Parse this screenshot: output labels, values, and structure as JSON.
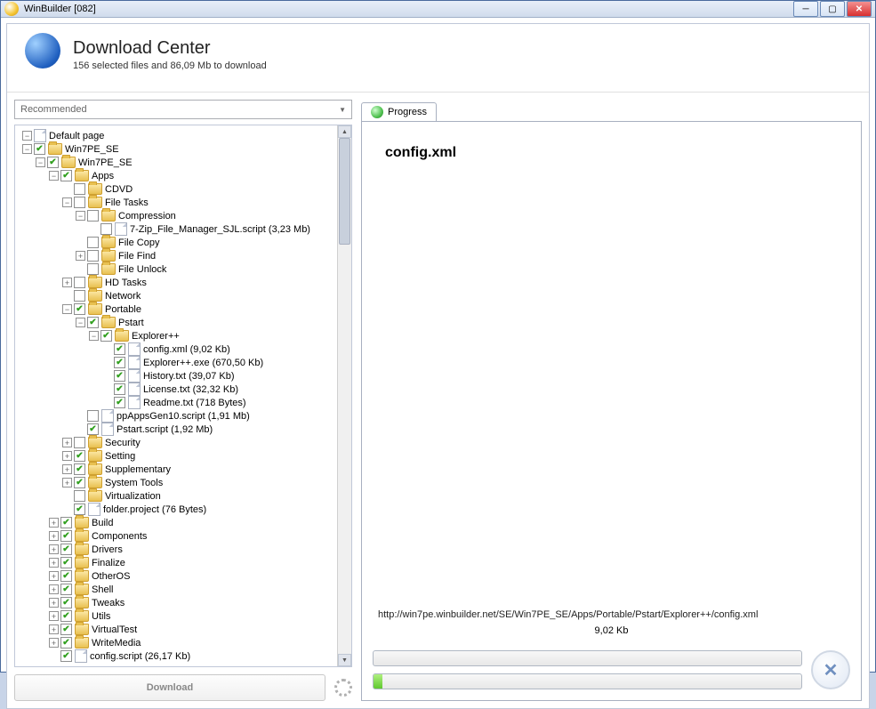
{
  "window": {
    "title": "WinBuilder [082]"
  },
  "header": {
    "title": "Download Center",
    "subtitle": "156 selected files and 86,09 Mb to download"
  },
  "combo": {
    "label": "Recommended"
  },
  "tree": [
    {
      "d": 0,
      "exp": "-",
      "chk": null,
      "ico": "file",
      "label": "Default page"
    },
    {
      "d": 0,
      "exp": "-",
      "chk": true,
      "ico": "folder",
      "label": "Win7PE_SE"
    },
    {
      "d": 1,
      "exp": "-",
      "chk": true,
      "ico": "folder",
      "label": "Win7PE_SE"
    },
    {
      "d": 2,
      "exp": "-",
      "chk": true,
      "ico": "folder",
      "label": "Apps"
    },
    {
      "d": 3,
      "exp": "",
      "chk": false,
      "ico": "folder",
      "label": "CDVD"
    },
    {
      "d": 3,
      "exp": "-",
      "chk": false,
      "ico": "folder",
      "label": "File Tasks"
    },
    {
      "d": 4,
      "exp": "-",
      "chk": false,
      "ico": "folder",
      "label": "Compression"
    },
    {
      "d": 5,
      "exp": "",
      "chk": false,
      "ico": "file",
      "label": "7-Zip_File_Manager_SJL.script (3,23 Mb)"
    },
    {
      "d": 4,
      "exp": "",
      "chk": false,
      "ico": "folder",
      "label": "File Copy"
    },
    {
      "d": 4,
      "exp": "+",
      "chk": false,
      "ico": "folder",
      "label": "File Find"
    },
    {
      "d": 4,
      "exp": "",
      "chk": false,
      "ico": "folder",
      "label": "File Unlock"
    },
    {
      "d": 3,
      "exp": "+",
      "chk": false,
      "ico": "folder",
      "label": "HD Tasks"
    },
    {
      "d": 3,
      "exp": "",
      "chk": false,
      "ico": "folder",
      "label": "Network"
    },
    {
      "d": 3,
      "exp": "-",
      "chk": true,
      "ico": "folder",
      "label": "Portable"
    },
    {
      "d": 4,
      "exp": "-",
      "chk": true,
      "ico": "folder",
      "label": "Pstart"
    },
    {
      "d": 5,
      "exp": "-",
      "chk": true,
      "ico": "folder",
      "label": "Explorer++"
    },
    {
      "d": 6,
      "exp": "",
      "chk": true,
      "ico": "file",
      "label": "config.xml (9,02 Kb)"
    },
    {
      "d": 6,
      "exp": "",
      "chk": true,
      "ico": "file",
      "label": "Explorer++.exe (670,50 Kb)"
    },
    {
      "d": 6,
      "exp": "",
      "chk": true,
      "ico": "file",
      "label": "History.txt (39,07 Kb)"
    },
    {
      "d": 6,
      "exp": "",
      "chk": true,
      "ico": "file",
      "label": "License.txt (32,32 Kb)"
    },
    {
      "d": 6,
      "exp": "",
      "chk": true,
      "ico": "file",
      "label": "Readme.txt (718 Bytes)"
    },
    {
      "d": 4,
      "exp": "",
      "chk": false,
      "ico": "file",
      "label": "ppAppsGen10.script (1,91 Mb)"
    },
    {
      "d": 4,
      "exp": "",
      "chk": true,
      "ico": "file",
      "label": "Pstart.script (1,92 Mb)"
    },
    {
      "d": 3,
      "exp": "+",
      "chk": false,
      "ico": "folder",
      "label": "Security"
    },
    {
      "d": 3,
      "exp": "+",
      "chk": true,
      "ico": "folder",
      "label": "Setting"
    },
    {
      "d": 3,
      "exp": "+",
      "chk": true,
      "ico": "folder",
      "label": "Supplementary"
    },
    {
      "d": 3,
      "exp": "+",
      "chk": true,
      "ico": "folder",
      "label": "System Tools"
    },
    {
      "d": 3,
      "exp": "",
      "chk": false,
      "ico": "folder",
      "label": "Virtualization"
    },
    {
      "d": 3,
      "exp": "",
      "chk": true,
      "ico": "file",
      "label": "folder.project (76 Bytes)"
    },
    {
      "d": 2,
      "exp": "+",
      "chk": true,
      "ico": "folder",
      "label": "Build"
    },
    {
      "d": 2,
      "exp": "+",
      "chk": true,
      "ico": "folder",
      "label": "Components"
    },
    {
      "d": 2,
      "exp": "+",
      "chk": true,
      "ico": "folder",
      "label": "Drivers"
    },
    {
      "d": 2,
      "exp": "+",
      "chk": true,
      "ico": "folder",
      "label": "Finalize"
    },
    {
      "d": 2,
      "exp": "+",
      "chk": true,
      "ico": "folder",
      "label": "OtherOS"
    },
    {
      "d": 2,
      "exp": "+",
      "chk": true,
      "ico": "folder",
      "label": "Shell"
    },
    {
      "d": 2,
      "exp": "+",
      "chk": true,
      "ico": "folder",
      "label": "Tweaks"
    },
    {
      "d": 2,
      "exp": "+",
      "chk": true,
      "ico": "folder",
      "label": "Utils"
    },
    {
      "d": 2,
      "exp": "+",
      "chk": true,
      "ico": "folder",
      "label": "VirtualTest"
    },
    {
      "d": 2,
      "exp": "+",
      "chk": true,
      "ico": "folder",
      "label": "WriteMedia"
    },
    {
      "d": 2,
      "exp": "",
      "chk": true,
      "ico": "file",
      "label": "config.script (26,17 Kb)"
    }
  ],
  "download_button": "Download",
  "progress_tab": "Progress",
  "progress": {
    "current_file": "config.xml",
    "url": "http://win7pe.winbuilder.net/SE/Win7PE_SE/Apps/Portable/Pstart/Explorer++/config.xml",
    "size": "9,02 Kb",
    "overall_pct": 0,
    "file_pct": 2
  }
}
